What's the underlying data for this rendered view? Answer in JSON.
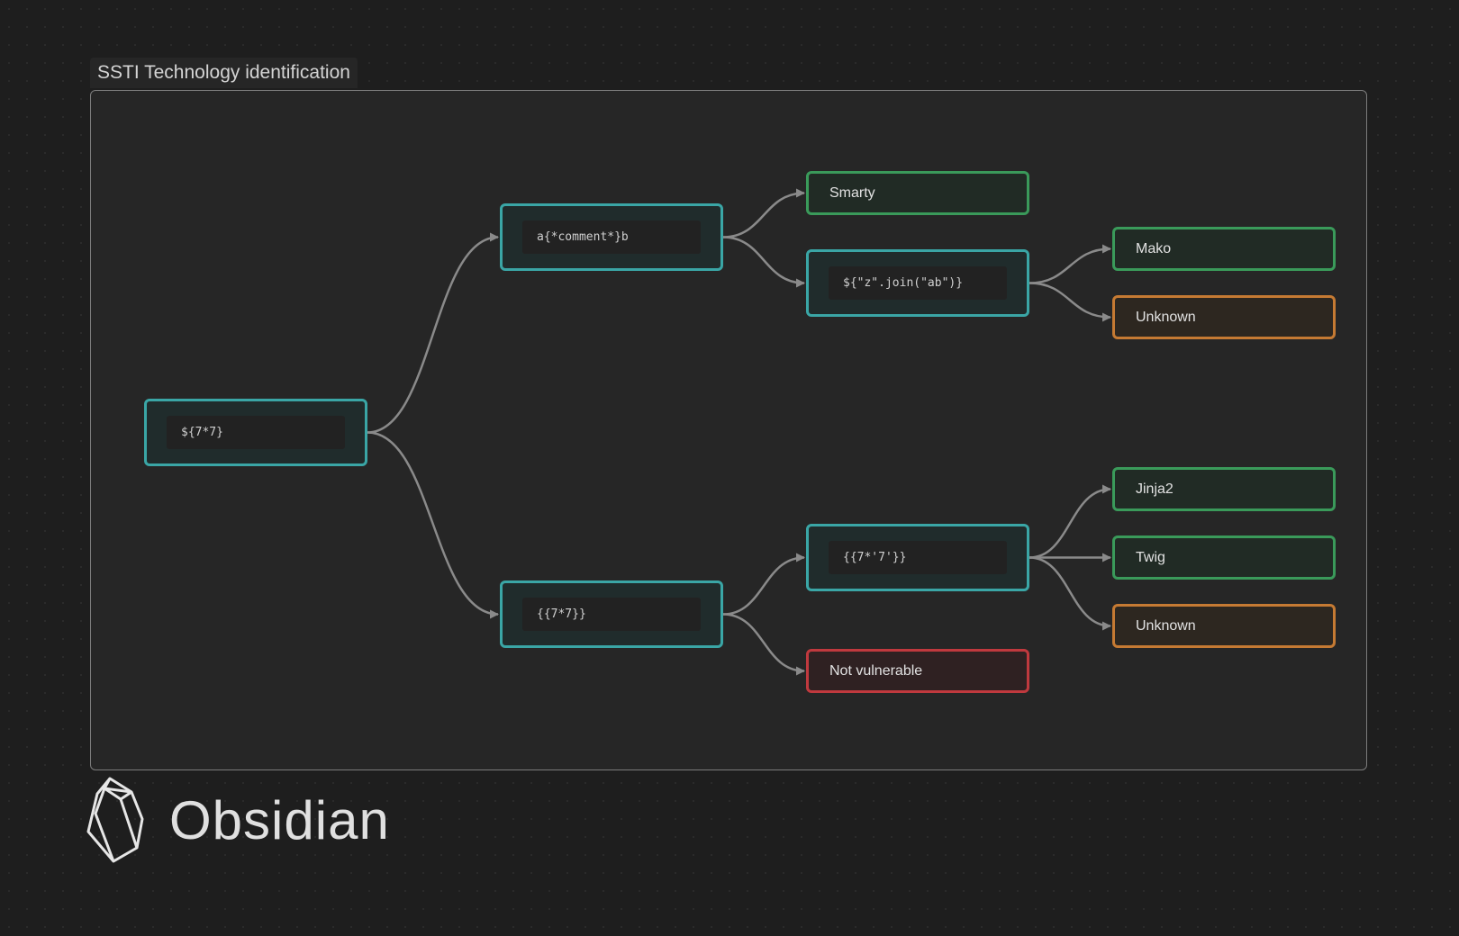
{
  "group": {
    "label": "SSTI Technology identification",
    "border_color": "#7c7c7c"
  },
  "nodes": {
    "root": {
      "text": "${7*7}",
      "kind": "payload"
    },
    "comment": {
      "text": "a{*comment*}b",
      "kind": "payload"
    },
    "double_braces": {
      "text": "{{7*7}}",
      "kind": "payload"
    },
    "join": {
      "text": "${\"z\".join(\"ab\")}",
      "kind": "payload"
    },
    "string_mult": {
      "text": "{{7*'7'}}",
      "kind": "payload"
    },
    "smarty": {
      "text": "Smarty",
      "kind": "result-positive"
    },
    "mako": {
      "text": "Mako",
      "kind": "result-positive"
    },
    "unknown_top": {
      "text": "Unknown",
      "kind": "result-unknown"
    },
    "jinja2": {
      "text": "Jinja2",
      "kind": "result-positive"
    },
    "twig": {
      "text": "Twig",
      "kind": "result-positive"
    },
    "unknown_bottom": {
      "text": "Unknown",
      "kind": "result-unknown"
    },
    "not_vulnerable": {
      "text": "Not vulnerable",
      "kind": "result-negative"
    }
  },
  "edges": [
    {
      "from": "root",
      "to": "comment"
    },
    {
      "from": "root",
      "to": "double_braces"
    },
    {
      "from": "comment",
      "to": "smarty"
    },
    {
      "from": "comment",
      "to": "join"
    },
    {
      "from": "join",
      "to": "mako"
    },
    {
      "from": "join",
      "to": "unknown_top"
    },
    {
      "from": "double_braces",
      "to": "string_mult"
    },
    {
      "from": "double_braces",
      "to": "not_vulnerable"
    },
    {
      "from": "string_mult",
      "to": "jinja2"
    },
    {
      "from": "string_mult",
      "to": "twig"
    },
    {
      "from": "string_mult",
      "to": "unknown_bottom"
    }
  ],
  "colors": {
    "payload": "#3aa6a6",
    "result_positive": "#3a9a5a",
    "result_unknown": "#c57a33",
    "result_negative": "#c0393e",
    "edge": "#8a8a8a"
  },
  "brand": {
    "name": "Obsidian",
    "logo_icon": "obsidian-logo-icon"
  }
}
